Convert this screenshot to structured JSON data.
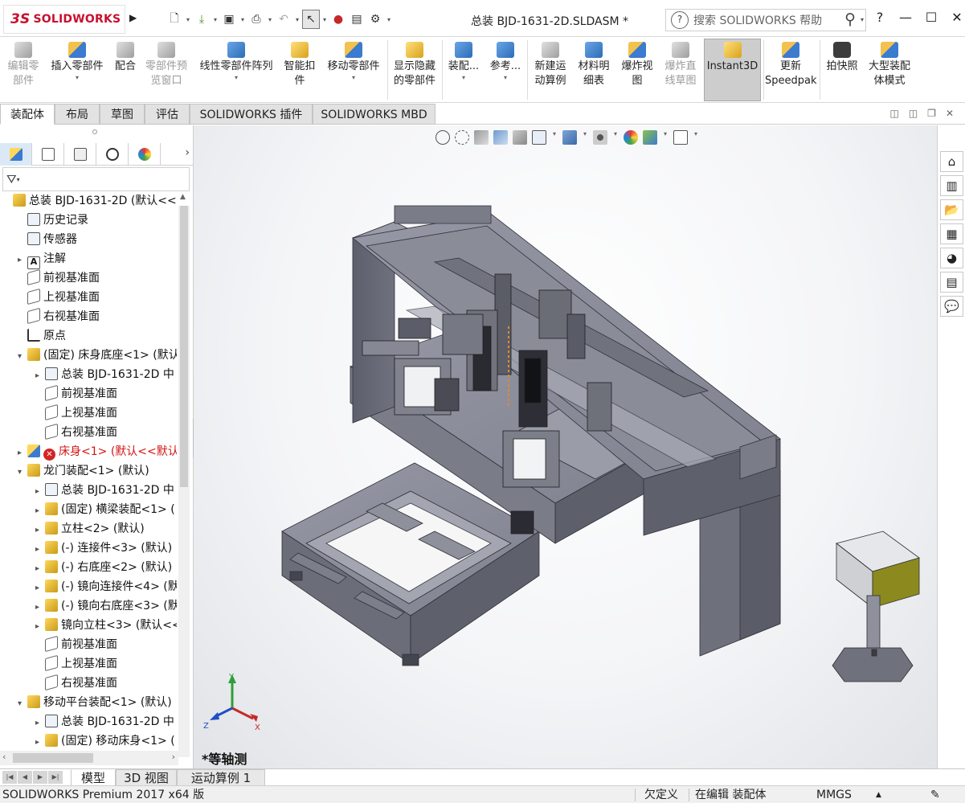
{
  "app": {
    "brand": "SOLIDWORKS",
    "brand_prefix": "3S",
    "document_title": "总装 BJD-1631-2D.SLDASM *"
  },
  "search": {
    "placeholder": "搜索 SOLIDWORKS 帮助",
    "help_mark": "?"
  },
  "window_controls": {
    "help": "?",
    "minimize": "—",
    "maximize": "☐",
    "close": "✕"
  },
  "quick_access": [
    {
      "name": "new-doc-icon",
      "glyph": "🗋"
    },
    {
      "name": "open-doc-icon",
      "glyph": "📂"
    },
    {
      "name": "save-icon",
      "glyph": "💾"
    },
    {
      "name": "print-icon",
      "glyph": "🖶"
    },
    {
      "name": "undo-icon",
      "glyph": "↶"
    },
    {
      "name": "select-cursor-icon",
      "glyph": "⇱"
    },
    {
      "name": "rebuild-traffic-light-icon",
      "glyph": "🚦"
    },
    {
      "name": "file-properties-icon",
      "glyph": "▤"
    },
    {
      "name": "options-gear-icon",
      "glyph": "⚙"
    }
  ],
  "commands": [
    {
      "label": "编辑零\n部件",
      "disabled": true,
      "icon": "gray"
    },
    {
      "label": "插入零部件",
      "disabled": false,
      "icon": "mix",
      "dropdown": true
    },
    {
      "label": "配合",
      "disabled": false,
      "icon": "gray"
    },
    {
      "label": "零部件预\n览窗口",
      "disabled": true,
      "icon": "gray"
    },
    {
      "label": "线性零部件阵列",
      "disabled": false,
      "icon": "blue",
      "dropdown": true
    },
    {
      "label": "智能扣\n件",
      "disabled": false,
      "icon": "yellow"
    },
    {
      "label": "移动零部件",
      "disabled": false,
      "icon": "mix",
      "dropdown": true
    },
    {
      "label": "显示隐藏\n的零部件",
      "disabled": false,
      "icon": "yellow"
    },
    {
      "label": "装配...",
      "disabled": false,
      "icon": "blue",
      "dropdown": true
    },
    {
      "label": "参考...",
      "disabled": false,
      "icon": "blue",
      "dropdown": true
    },
    {
      "label": "新建运\n动算例",
      "disabled": false,
      "icon": "gray"
    },
    {
      "label": "材料明\n细表",
      "disabled": false,
      "icon": "blue"
    },
    {
      "label": "爆炸视\n图",
      "disabled": false,
      "icon": "mix"
    },
    {
      "label": "爆炸直\n线草图",
      "disabled": true,
      "icon": "gray"
    },
    {
      "label": "Instant3D",
      "disabled": false,
      "icon": "yellow"
    },
    {
      "label": "更新\nSpeedpak",
      "disabled": false,
      "icon": "mix"
    },
    {
      "label": "拍快照",
      "disabled": false,
      "icon": "cam"
    },
    {
      "label": "大型装配\n体模式",
      "disabled": false,
      "icon": "mix"
    }
  ],
  "tabs": [
    "装配体",
    "布局",
    "草图",
    "评估",
    "SOLIDWORKS 插件",
    "SOLIDWORKS MBD"
  ],
  "active_tab": "装配体",
  "tree": [
    {
      "label": "总装 BJD-1631-2D  (默认<<",
      "icon": "asm",
      "expander": "",
      "level": 0
    },
    {
      "label": "历史记录",
      "icon": "folder",
      "expander": "",
      "level": 1
    },
    {
      "label": "传感器",
      "icon": "folder",
      "expander": "",
      "level": 1
    },
    {
      "label": "注解",
      "icon": "note",
      "expander": "▸",
      "level": 1
    },
    {
      "label": "前视基准面",
      "icon": "plane",
      "expander": "",
      "level": 1
    },
    {
      "label": "上视基准面",
      "icon": "plane",
      "expander": "",
      "level": 1
    },
    {
      "label": "右视基准面",
      "icon": "plane",
      "expander": "",
      "level": 1
    },
    {
      "label": "原点",
      "icon": "origin",
      "expander": "",
      "level": 1
    },
    {
      "label": "(固定) 床身底座<1> (默认",
      "icon": "asm",
      "expander": "▾",
      "level": 1
    },
    {
      "label": "总装 BJD-1631-2D 中",
      "icon": "folder",
      "expander": "▸",
      "level": 2
    },
    {
      "label": "前视基准面",
      "icon": "plane",
      "expander": "",
      "level": 2
    },
    {
      "label": "上视基准面",
      "icon": "plane",
      "expander": "",
      "level": 2
    },
    {
      "label": "右视基准面",
      "icon": "plane",
      "expander": "",
      "level": 2
    },
    {
      "label": "床身<1> (默认<<默认",
      "icon": "part",
      "expander": "▸",
      "level": 1,
      "error": true
    },
    {
      "label": "龙门装配<1> (默认)",
      "icon": "asm",
      "expander": "▾",
      "level": 1
    },
    {
      "label": "总装 BJD-1631-2D 中",
      "icon": "folder",
      "expander": "▸",
      "level": 2
    },
    {
      "label": "(固定) 横梁装配<1> (",
      "icon": "asm",
      "expander": "▸",
      "level": 2
    },
    {
      "label": "立柱<2> (默认)",
      "icon": "asm",
      "expander": "▸",
      "level": 2
    },
    {
      "label": "(-) 连接件<3> (默认)",
      "icon": "asm",
      "expander": "▸",
      "level": 2
    },
    {
      "label": "(-) 右底座<2> (默认)",
      "icon": "asm",
      "expander": "▸",
      "level": 2
    },
    {
      "label": "(-) 镜向连接件<4> (默",
      "icon": "asm",
      "expander": "▸",
      "level": 2
    },
    {
      "label": "(-) 镜向右底座<3> (默",
      "icon": "asm",
      "expander": "▸",
      "level": 2
    },
    {
      "label": "镜向立柱<3> (默认<<",
      "icon": "asm",
      "expander": "▸",
      "level": 2
    },
    {
      "label": "前视基准面",
      "icon": "plane",
      "expander": "",
      "level": 2
    },
    {
      "label": "上视基准面",
      "icon": "plane",
      "expander": "",
      "level": 2
    },
    {
      "label": "右视基准面",
      "icon": "plane",
      "expander": "",
      "level": 2
    },
    {
      "label": "移动平台装配<1> (默认)",
      "icon": "asm",
      "expander": "▾",
      "level": 1
    },
    {
      "label": "总装 BJD-1631-2D 中",
      "icon": "folder",
      "expander": "▸",
      "level": 2
    },
    {
      "label": "(固定) 移动床身<1> (",
      "icon": "asm",
      "expander": "▸",
      "level": 2
    }
  ],
  "viewport": {
    "view_name": "*等轴测"
  },
  "triad": {
    "x": "X",
    "y": "Y",
    "z": "Z"
  },
  "bottom_tabs": [
    "模型",
    "3D 视图",
    "运动算例 1"
  ],
  "active_bottom_tab": "模型",
  "status": {
    "product": "SOLIDWORKS Premium 2017 x64 版",
    "definition": "欠定义",
    "editing": "在编辑 装配体",
    "units": "MMGS"
  },
  "colors": {
    "accent": "#c8102e",
    "error": "#d01515",
    "instant3d_bg": "#cdcdcd",
    "model_gray": "#8a8c9a"
  }
}
